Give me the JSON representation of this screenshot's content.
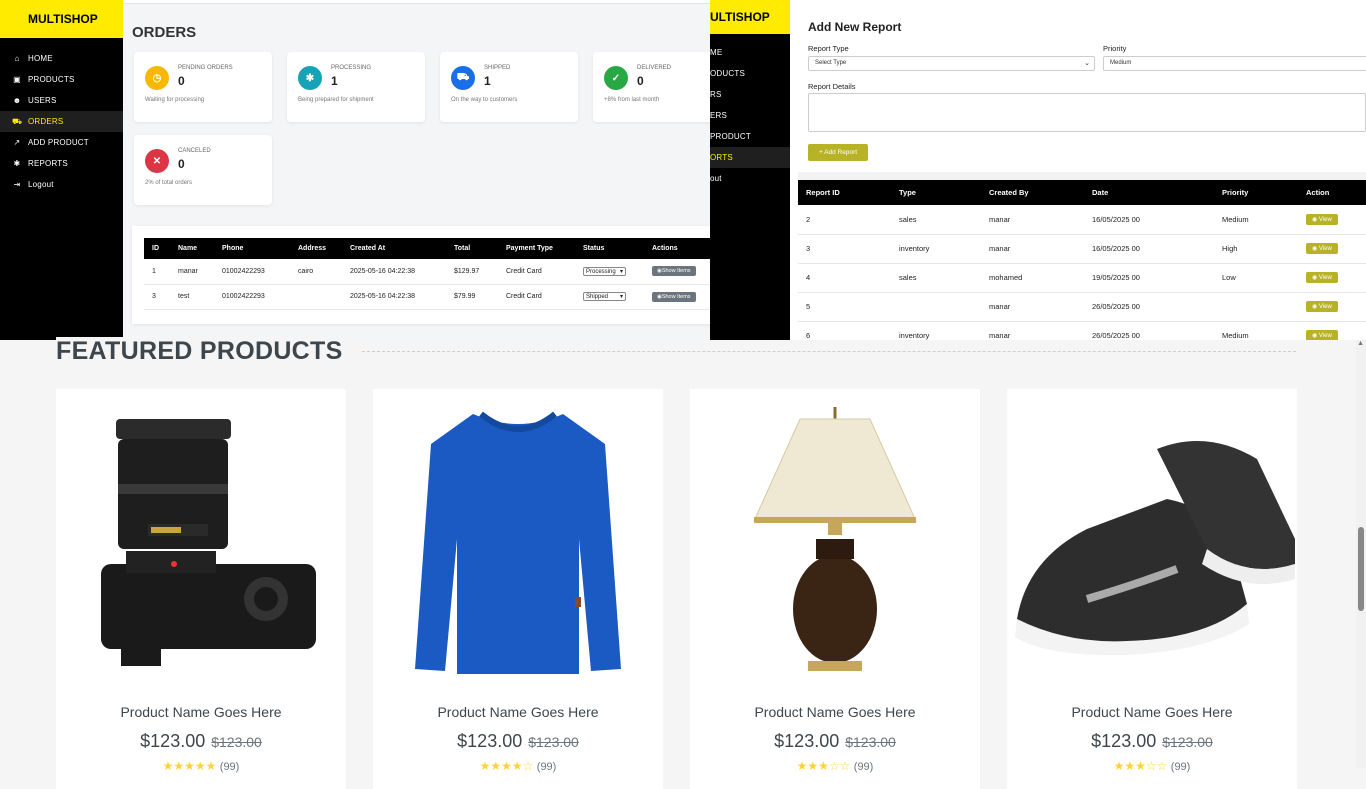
{
  "orders_panel": {
    "brand": "MULTISHOP",
    "nav": [
      {
        "icon": "home-icon",
        "glyph": "⌂",
        "label": "HOME",
        "active": false
      },
      {
        "icon": "box-icon",
        "glyph": "▣",
        "label": "PRODUCTS",
        "active": false
      },
      {
        "icon": "users-icon",
        "glyph": "☻",
        "label": "USERS",
        "active": false
      },
      {
        "icon": "cart-icon",
        "glyph": "⛟",
        "label": "ORDERS",
        "active": true
      },
      {
        "icon": "chart-icon",
        "glyph": "↗",
        "label": "ADD PRODUCT",
        "active": false
      },
      {
        "icon": "gear-icon",
        "glyph": "✱",
        "label": "REPORTS",
        "active": false
      },
      {
        "icon": "logout-icon",
        "glyph": "⇥",
        "label": "Logout",
        "active": false
      }
    ],
    "title": "ORDERS",
    "stats": [
      {
        "label": "PENDING ORDERS",
        "value": "0",
        "sub": "Waiting for processing",
        "color": "#f7b900",
        "glyph": "◷",
        "icon": "clock-icon"
      },
      {
        "label": "PROCESSING",
        "value": "1",
        "sub": "Being prepared for shipment",
        "color": "#17a2b8",
        "glyph": "✱",
        "icon": "gear-icon"
      },
      {
        "label": "SHIPPED",
        "value": "1",
        "sub": "On the way to customers",
        "color": "#1a6fe8",
        "glyph": "⛟",
        "icon": "truck-icon"
      },
      {
        "label": "DELIVERED",
        "value": "0",
        "sub": "+8% from last month",
        "color": "#28a745",
        "glyph": "✓",
        "icon": "check-icon"
      },
      {
        "label": "CANCELED",
        "value": "0",
        "sub": "2% of total orders",
        "color": "#dc3545",
        "glyph": "✕",
        "icon": "cancel-icon"
      }
    ],
    "table": {
      "headers": [
        "ID",
        "Name",
        "Phone",
        "Address",
        "Created At",
        "Total",
        "Payment Type",
        "Status",
        "Actions"
      ],
      "rows": [
        {
          "id": "1",
          "name": "manar",
          "phone": "01002422293",
          "address": "cairo",
          "created": "2025-05-16 04:22:38",
          "total": "$129.97",
          "payment": "Credit Card",
          "status": "Processing",
          "action": "Show Items"
        },
        {
          "id": "3",
          "name": "test",
          "phone": "01002422293",
          "address": "",
          "created": "2025-05-16 04:22:38",
          "total": "$79.99",
          "payment": "Credit Card",
          "status": "Shipped",
          "action": "Show Items"
        }
      ]
    }
  },
  "reports_panel": {
    "brand": "ULTISHOP",
    "nav": [
      "ME",
      "ODUCTS",
      "RS",
      "ERS",
      "PRODUCT",
      "ORTS",
      "out"
    ],
    "active_nav_index": 5,
    "title": "Add New Report",
    "type_label": "Report Type",
    "type_value": "Select Type",
    "priority_label": "Priority",
    "priority_value": "Medium",
    "details_label": "Report Details",
    "add_button": "+ Add Report",
    "table": {
      "headers": [
        "Report ID",
        "Type",
        "Created By",
        "Date",
        "Priority",
        "Action"
      ],
      "rows": [
        {
          "id": "2",
          "type": "sales",
          "by": "manar",
          "date": "16/05/2025 00",
          "priority": "Medium",
          "action": "View"
        },
        {
          "id": "3",
          "type": "inventory",
          "by": "manar",
          "date": "16/05/2025 00",
          "priority": "High",
          "action": "View"
        },
        {
          "id": "4",
          "type": "sales",
          "by": "mohamed",
          "date": "19/05/2025 00",
          "priority": "Low",
          "action": "View"
        },
        {
          "id": "5",
          "type": "",
          "by": "manar",
          "date": "26/05/2025 00",
          "priority": "",
          "action": "View"
        },
        {
          "id": "6",
          "type": "inventory",
          "by": "manar",
          "date": "26/05/2025 00",
          "priority": "Medium",
          "action": "View"
        }
      ]
    }
  },
  "featured": {
    "title": "FEATURED PRODUCTS",
    "products": [
      {
        "image": "camera",
        "name": "Product Name Goes Here",
        "price": "$123.00",
        "old_price": "$123.00",
        "stars": "★★★★★",
        "count": "(99)"
      },
      {
        "image": "sweater",
        "name": "Product Name Goes Here",
        "price": "$123.00",
        "old_price": "$123.00",
        "stars": "★★★★☆",
        "count": "(99)"
      },
      {
        "image": "lamp",
        "name": "Product Name Goes Here",
        "price": "$123.00",
        "old_price": "$123.00",
        "stars": "★★★☆☆",
        "count": "(99)"
      },
      {
        "image": "shoes",
        "name": "Product Name Goes Here",
        "price": "$123.00",
        "old_price": "$123.00",
        "stars": "★★★☆☆",
        "count": "(99)"
      }
    ]
  }
}
